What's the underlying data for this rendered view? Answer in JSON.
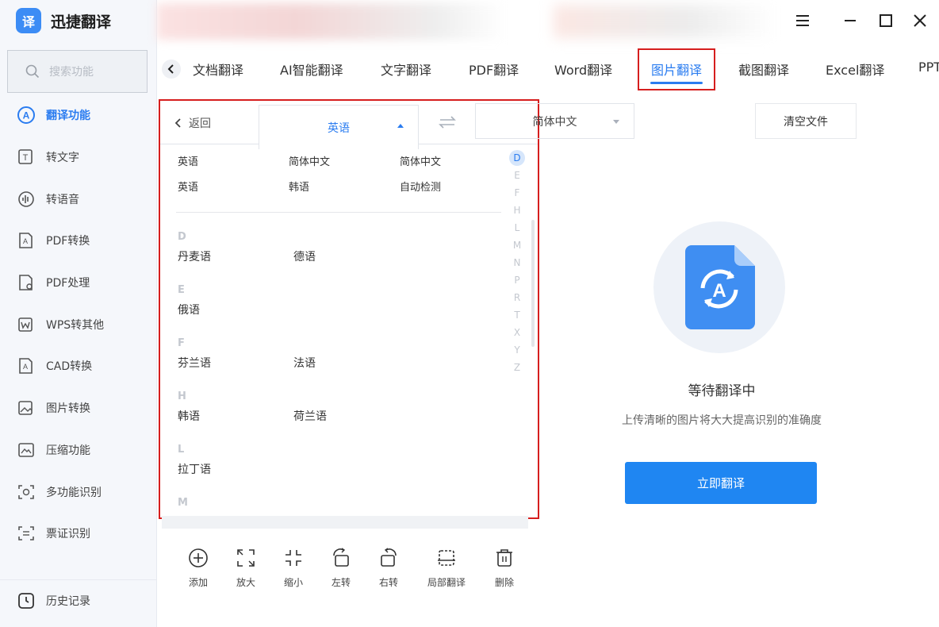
{
  "app": {
    "name": "迅捷翻译",
    "logo_char": "译"
  },
  "search": {
    "placeholder": "搜索功能"
  },
  "sidebar": {
    "items": [
      {
        "label": "翻译功能",
        "icon": "translate-icon",
        "active": true
      },
      {
        "label": "转文字",
        "icon": "text-convert-icon"
      },
      {
        "label": "转语音",
        "icon": "voice-icon"
      },
      {
        "label": "PDF转换",
        "icon": "pdf-convert-icon"
      },
      {
        "label": "PDF处理",
        "icon": "pdf-process-icon"
      },
      {
        "label": "WPS转其他",
        "icon": "wps-icon"
      },
      {
        "label": "CAD转换",
        "icon": "cad-icon"
      },
      {
        "label": "图片转换",
        "icon": "image-convert-icon"
      },
      {
        "label": "压缩功能",
        "icon": "compress-icon"
      },
      {
        "label": "多功能识别",
        "icon": "recognize-icon"
      },
      {
        "label": "票证识别",
        "icon": "ticket-icon"
      }
    ],
    "history_label": "历史记录"
  },
  "tabs": [
    {
      "label": "文档翻译"
    },
    {
      "label": "AI智能翻译"
    },
    {
      "label": "文字翻译"
    },
    {
      "label": "PDF翻译"
    },
    {
      "label": "Word翻译"
    },
    {
      "label": "图片翻译",
      "active": true
    },
    {
      "label": "截图翻译"
    },
    {
      "label": "Excel翻译"
    },
    {
      "label": "PPT"
    }
  ],
  "lang_panel": {
    "back_label": "返回",
    "source_lang": "英语",
    "target_lang": "简体中文",
    "recent": [
      [
        "英语",
        "简体中文",
        "简体中文"
      ],
      [
        "英语",
        "韩语",
        "自动检测"
      ]
    ],
    "groups": [
      {
        "letter": "D",
        "items": [
          "丹麦语",
          "德语"
        ]
      },
      {
        "letter": "E",
        "items": [
          "俄语"
        ]
      },
      {
        "letter": "F",
        "items": [
          "芬兰语",
          "法语"
        ]
      },
      {
        "letter": "H",
        "items": [
          "韩语",
          "荷兰语"
        ]
      },
      {
        "letter": "L",
        "items": [
          "拉丁语"
        ]
      },
      {
        "letter": "M",
        "items": []
      }
    ],
    "alphabet": [
      "D",
      "E",
      "F",
      "H",
      "L",
      "M",
      "N",
      "P",
      "R",
      "T",
      "X",
      "Y",
      "Z"
    ],
    "alphabet_active": "D"
  },
  "clear_button": "清空文件",
  "empty_state": {
    "title": "等待翻译中",
    "subtitle": "上传清晰的图片将大大提高识别的准确度",
    "icon": "image-translate-icon"
  },
  "translate_button": "立即翻译",
  "toolbar": [
    {
      "label": "添加",
      "icon": "add-icon"
    },
    {
      "label": "放大",
      "icon": "expand-icon"
    },
    {
      "label": "缩小",
      "icon": "shrink-icon"
    },
    {
      "label": "左转",
      "icon": "rotate-left-icon"
    },
    {
      "label": "右转",
      "icon": "rotate-right-icon"
    },
    {
      "label": "局部翻译",
      "icon": "crop-translate-icon"
    },
    {
      "label": "删除",
      "icon": "delete-icon"
    }
  ],
  "colors": {
    "accent": "#2a7cf0",
    "highlight_box": "#d61e1e",
    "button": "#1f86f2"
  }
}
